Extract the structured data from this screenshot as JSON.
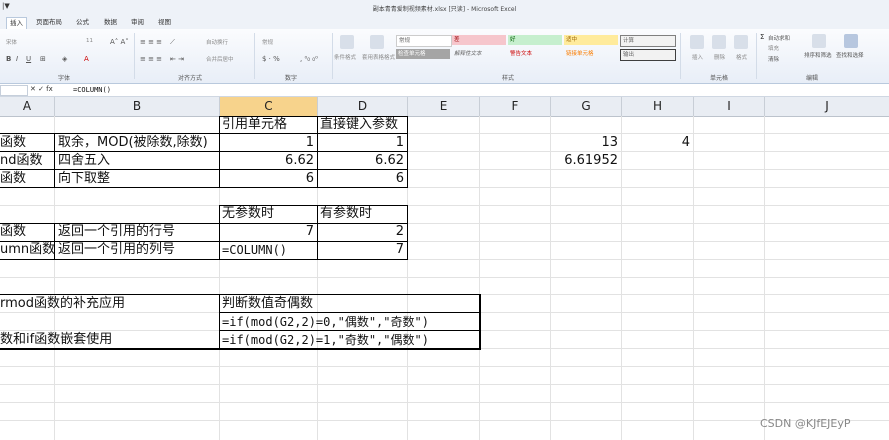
{
  "window": {
    "title": "副本青青爱制视频素材.xlsx [只读] - Microsoft Excel",
    "qat": "|▼"
  },
  "menu": [
    {
      "label": "插入"
    },
    {
      "label": "页面布局"
    },
    {
      "label": "公式"
    },
    {
      "label": "数据"
    },
    {
      "label": "审阅"
    },
    {
      "label": "视图"
    }
  ],
  "ribbon": {
    "font_name": "宋体",
    "font_size": "11",
    "wrap_text": "自动换行",
    "merge_center": "合并后居中",
    "number_format": "常规",
    "cond_format": "条件格式",
    "table_format": "套用表格格式",
    "styles": [
      "常规",
      "差",
      "好",
      "适中",
      "计算",
      "检查单元格",
      "解释性文本",
      "警告文本",
      "链接单元格",
      "输出"
    ],
    "insert": "插入",
    "delete": "删除",
    "format": "格式",
    "autosum": "自动求和",
    "fill": "填充",
    "clear": "清除",
    "sort_filter": "排序和筛选",
    "find_select": "查找和选择",
    "groups": {
      "font": "字体",
      "alignment": "对齐方式",
      "number": "数字",
      "styles": "样式",
      "cells": "单元格",
      "editing": "编辑"
    }
  },
  "formula_bar": {
    "fx": "✕ ✓ fx",
    "formula": "=COLUMN()"
  },
  "columns": [
    "A",
    "B",
    "C",
    "D",
    "E",
    "F",
    "G",
    "H",
    "I",
    "J"
  ],
  "selected_column": "C",
  "cells": {
    "c1": "引用单元格",
    "d1": "直接键入参数",
    "a2": "函数",
    "b2": "取余，MOD(被除数,除数)",
    "c2": "1",
    "d2": "1",
    "g2": "13",
    "h2": "4",
    "a3": "nd函数",
    "b3": "四舍五入",
    "c3": "6.62",
    "d3": "6.62",
    "g3": "6.61952",
    "a4": "函数",
    "b4": "向下取整",
    "c4": "6",
    "d4": "6",
    "c6": "无参数时",
    "d6": "有参数时",
    "a7": "函数",
    "b7": "返回一个引用的行号",
    "c7": "7",
    "d7": "2",
    "a8": "umn函数",
    "b8": "返回一个引用的列号",
    "c8": "=COLUMN()",
    "d8": "7",
    "a10": "rmod函数的补充应用",
    "c10": "判断数值奇偶数",
    "c11": "=if(mod(G2,2)=0,\"偶数\",\"奇数\")",
    "a12": "数和if函数嵌套使用",
    "c12": "=if(mod(G2,2)=1,\"奇数\",\"偶数\")"
  },
  "watermark": "CSDN @KJfEJEyP"
}
